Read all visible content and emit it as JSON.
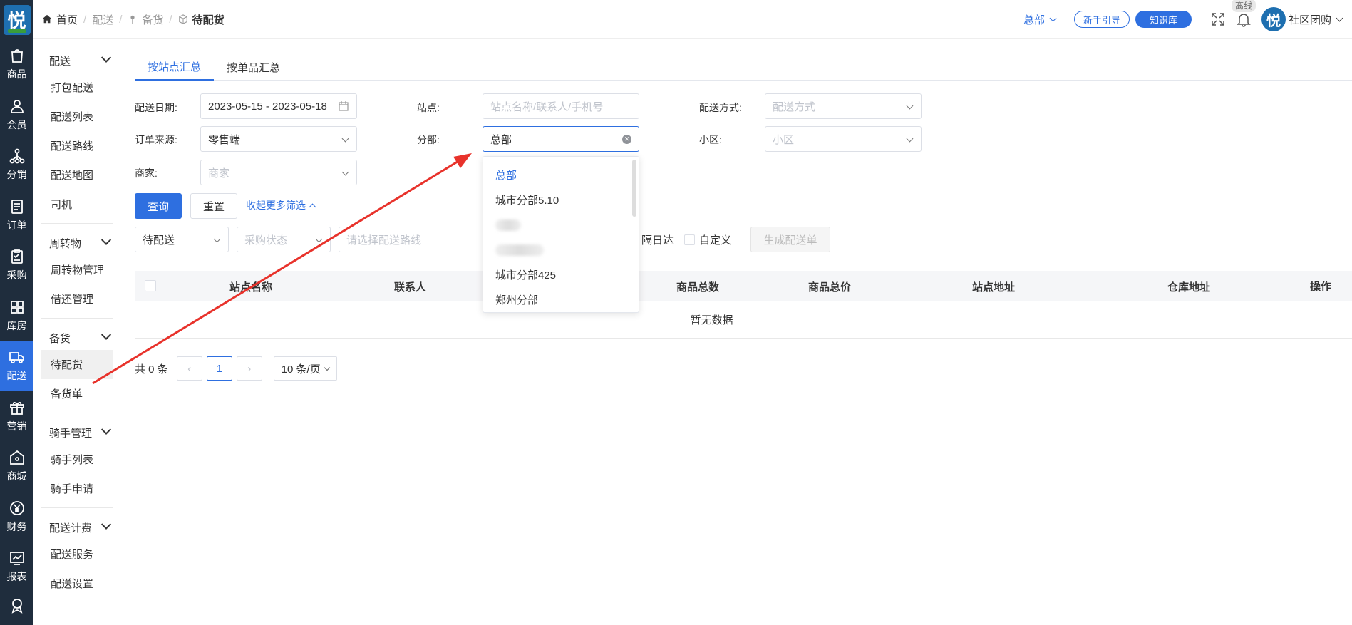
{
  "rail": {
    "logo": "悦",
    "items": [
      {
        "label": "商品",
        "icon": "shopping-bag-icon"
      },
      {
        "label": "会员",
        "icon": "user-icon"
      },
      {
        "label": "分销",
        "icon": "network-icon"
      },
      {
        "label": "订单",
        "icon": "document-icon"
      },
      {
        "label": "采购",
        "icon": "clipboard-icon"
      },
      {
        "label": "库房",
        "icon": "grid-icon"
      },
      {
        "label": "配送",
        "icon": "truck-icon"
      },
      {
        "label": "营销",
        "icon": "gift-icon"
      },
      {
        "label": "商城",
        "icon": "store-icon"
      },
      {
        "label": "财务",
        "icon": "yen-icon"
      },
      {
        "label": "报表",
        "icon": "chart-icon"
      }
    ]
  },
  "submenu": {
    "groups": [
      {
        "title": "配送",
        "items": [
          "打包配送",
          "配送列表",
          "配送路线",
          "配送地图",
          "司机"
        ]
      },
      {
        "title": "周转物",
        "items": [
          "周转物管理",
          "借还管理"
        ]
      },
      {
        "title": "备货",
        "items": [
          "待配货",
          "备货单"
        ]
      },
      {
        "title": "骑手管理",
        "items": [
          "骑手列表",
          "骑手申请"
        ]
      },
      {
        "title": "配送计费",
        "items": [
          "配送服务",
          "配送设置"
        ]
      }
    ]
  },
  "breadcrumb": {
    "home": "首页",
    "b1": "配送",
    "b2": "备货",
    "current": "待配货"
  },
  "topbar": {
    "branch": "总部",
    "guide": "新手引导",
    "kb": "知识库",
    "offline": "离线",
    "avatar": "悦",
    "user": "社区团购"
  },
  "tabs": [
    "按站点汇总",
    "按单品汇总"
  ],
  "filters": {
    "date_label": "配送日期:",
    "date_value": "2023-05-15 - 2023-05-18",
    "site_label": "站点:",
    "site_placeholder": "站点名称/联系人/手机号",
    "method_label": "配送方式:",
    "method_placeholder": "配送方式",
    "source_label": "订单来源:",
    "source_value": "零售端",
    "branch_label": "分部:",
    "branch_value": "总部",
    "community_label": "小区:",
    "community_placeholder": "小区",
    "merchant_label": "商家:",
    "merchant_placeholder": "商家"
  },
  "actions": {
    "query": "查询",
    "reset": "重置",
    "collapse": "收起更多筛选"
  },
  "toolbar": {
    "status": "待配送",
    "purchase_placeholder": "采购状态",
    "route_placeholder": "请选择配送路线",
    "next_day": "隔日达",
    "custom": "自定义",
    "generate": "生成配送单"
  },
  "table": {
    "columns": [
      "站点名称",
      "联系人",
      "商品总数",
      "商品总价",
      "站点地址",
      "仓库地址"
    ],
    "ops": "操作",
    "empty": "暂无数据"
  },
  "pager": {
    "total": "共 0 条",
    "prev": "‹",
    "page": "1",
    "next": "›",
    "size": "10 条/页"
  },
  "dropdown": {
    "options": [
      "总部",
      "城市分部5.10",
      "城市分部425",
      "郑州分部"
    ]
  },
  "colors": {
    "primary": "#2e6fe0",
    "rail": "#1f2d3d",
    "arrow": "#e8322b"
  }
}
